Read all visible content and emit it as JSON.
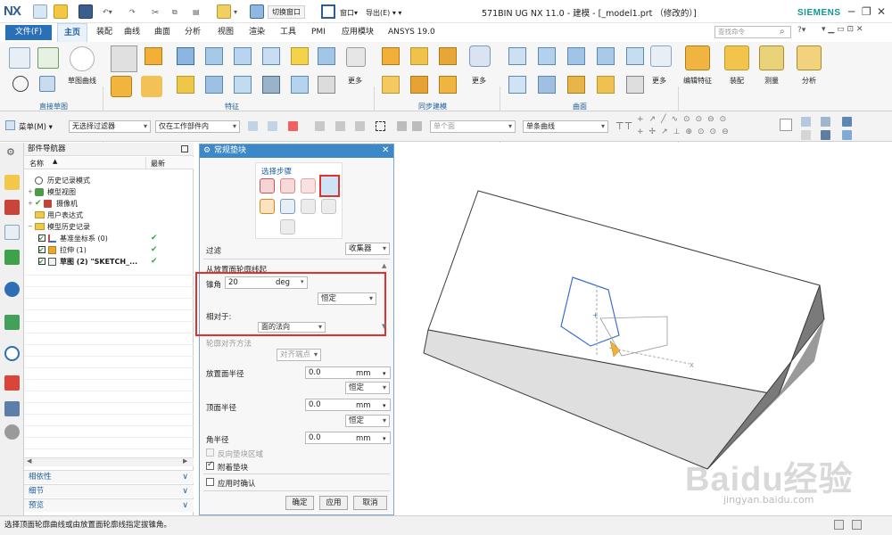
{
  "app": {
    "logo": "NX",
    "title": "571BIN UG NX 11.0 - 建模 - [_model1.prt （修改的）]",
    "brand": "SIEMENS"
  },
  "quick": {
    "switch_window": "切换窗口",
    "window": "窗口",
    "export": "导出(E)"
  },
  "menu": {
    "file": "文件(F)",
    "tabs": [
      "主页",
      "装配",
      "曲线",
      "曲面",
      "分析",
      "视图",
      "渲染",
      "工具",
      "PMI",
      "应用模块",
      "ANSYS 19.0"
    ],
    "search_placeholder": "查找命令"
  },
  "ribbon": {
    "groups": [
      "直接草图",
      "特征",
      "同步建模",
      "曲面"
    ],
    "labels": {
      "sketch_curve": "草图曲线",
      "more1": "更多",
      "more2": "更多",
      "more3": "更多",
      "edit_feature": "编辑特征",
      "assembly": "装配",
      "measure": "测量",
      "analysis": "分析"
    }
  },
  "selection": {
    "menu": "菜单(M)",
    "filter": "无选择过滤器",
    "scope": "仅在工作部件内",
    "face_rule": "单个面",
    "curve_rule": "单条曲线"
  },
  "navigator": {
    "title": "部件导航器",
    "col_name": "名称",
    "col_new": "最新",
    "items": [
      {
        "label": "历史记录模式"
      },
      {
        "label": "模型视图"
      },
      {
        "label": "摄像机"
      },
      {
        "label": "用户表达式"
      },
      {
        "label": "模型历史记录"
      },
      {
        "label": "基准坐标系 (0)"
      },
      {
        "label": "拉伸 (1)"
      },
      {
        "label": "草图 (2) \"SKETCH_..."
      }
    ],
    "sections": [
      "相依性",
      "细节",
      "预览"
    ]
  },
  "dialog": {
    "title": "常规垫块",
    "select_steps": "选择步骤",
    "filter_label": "过滤",
    "filter_value": "收集器",
    "section1": "从放置面轮廓线起",
    "taper_label": "锥角",
    "taper_value": "20",
    "taper_unit": "deg",
    "mode_value": "恒定",
    "relative_label": "相对于:",
    "relative_value": "面的法向",
    "align_label": "轮廓对齐方法",
    "align_value": "对齐端点",
    "place_radius_label": "放置面半径",
    "place_radius_value": "0.0",
    "top_radius_label": "顶面半径",
    "top_radius_value": "0.0",
    "corner_radius_label": "角半径",
    "corner_radius_value": "0.0",
    "unit_mm": "mm",
    "const1": "恒定",
    "const2": "恒定",
    "reverse_label": "反向垫块区域",
    "attach_label": "附着垫块",
    "confirm_label": "应用时确认",
    "ok": "确定",
    "apply": "应用",
    "cancel": "取消",
    "attach_checked": true,
    "confirm_checked": false
  },
  "status": {
    "text": "选择顶面轮廓曲线或由放置面轮廓线指定拔锥角。"
  },
  "watermark": {
    "main": "Baidu经验",
    "sub": "jingyan.baidu.com"
  },
  "colors": {
    "accent": "#2970b6",
    "check": "#3aa53a",
    "highlight_box": "#e0312c",
    "dlg_header": "#3d88c6"
  }
}
